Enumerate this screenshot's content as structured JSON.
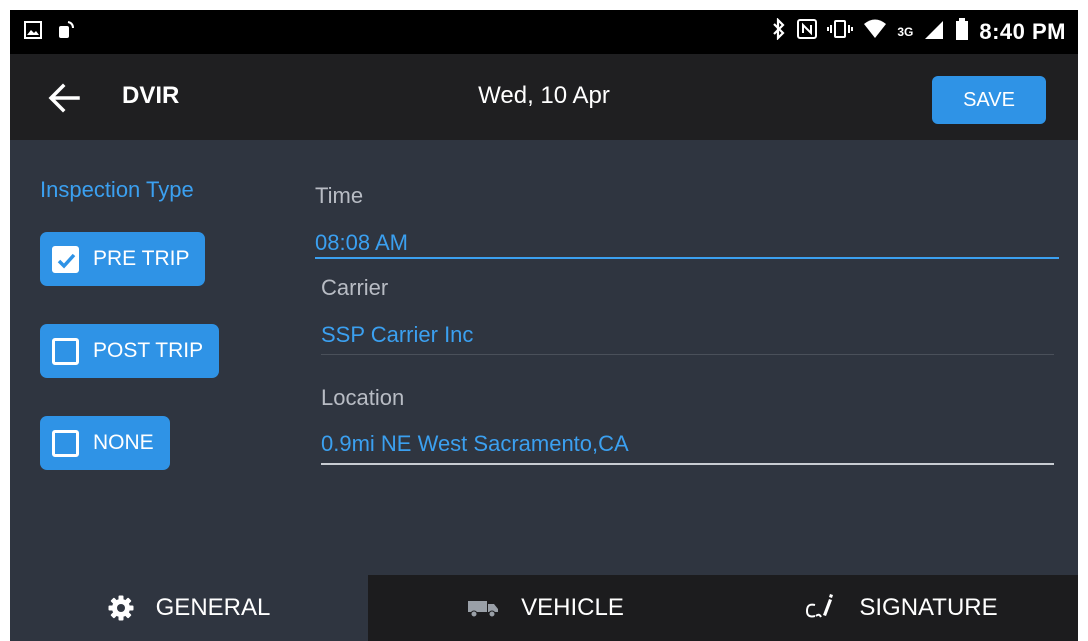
{
  "status_bar": {
    "network": "3G",
    "time": "8:40 PM"
  },
  "app_bar": {
    "title": "DVIR",
    "date": "Wed, 10 Apr",
    "save_label": "SAVE"
  },
  "inspection": {
    "heading": "Inspection Type",
    "options": [
      {
        "label": "PRE TRIP",
        "checked": true
      },
      {
        "label": "POST TRIP",
        "checked": false
      },
      {
        "label": "NONE",
        "checked": false
      }
    ]
  },
  "form": {
    "time_label": "Time",
    "time_value": "08:08 AM",
    "carrier_label": "Carrier",
    "carrier_value": "SSP Carrier Inc",
    "location_label": "Location",
    "location_value": "0.9mi NE West Sacramento,CA"
  },
  "tabs": [
    {
      "label": "GENERAL",
      "icon": "gear-icon",
      "active": true
    },
    {
      "label": "VEHICLE",
      "icon": "truck-icon",
      "active": false
    },
    {
      "label": "SIGNATURE",
      "icon": "signature-icon",
      "active": false
    }
  ],
  "colors": {
    "accent": "#2f93e6",
    "accent_text": "#3ba0f0",
    "background": "#2f3540",
    "app_bar": "#1f1f21"
  }
}
